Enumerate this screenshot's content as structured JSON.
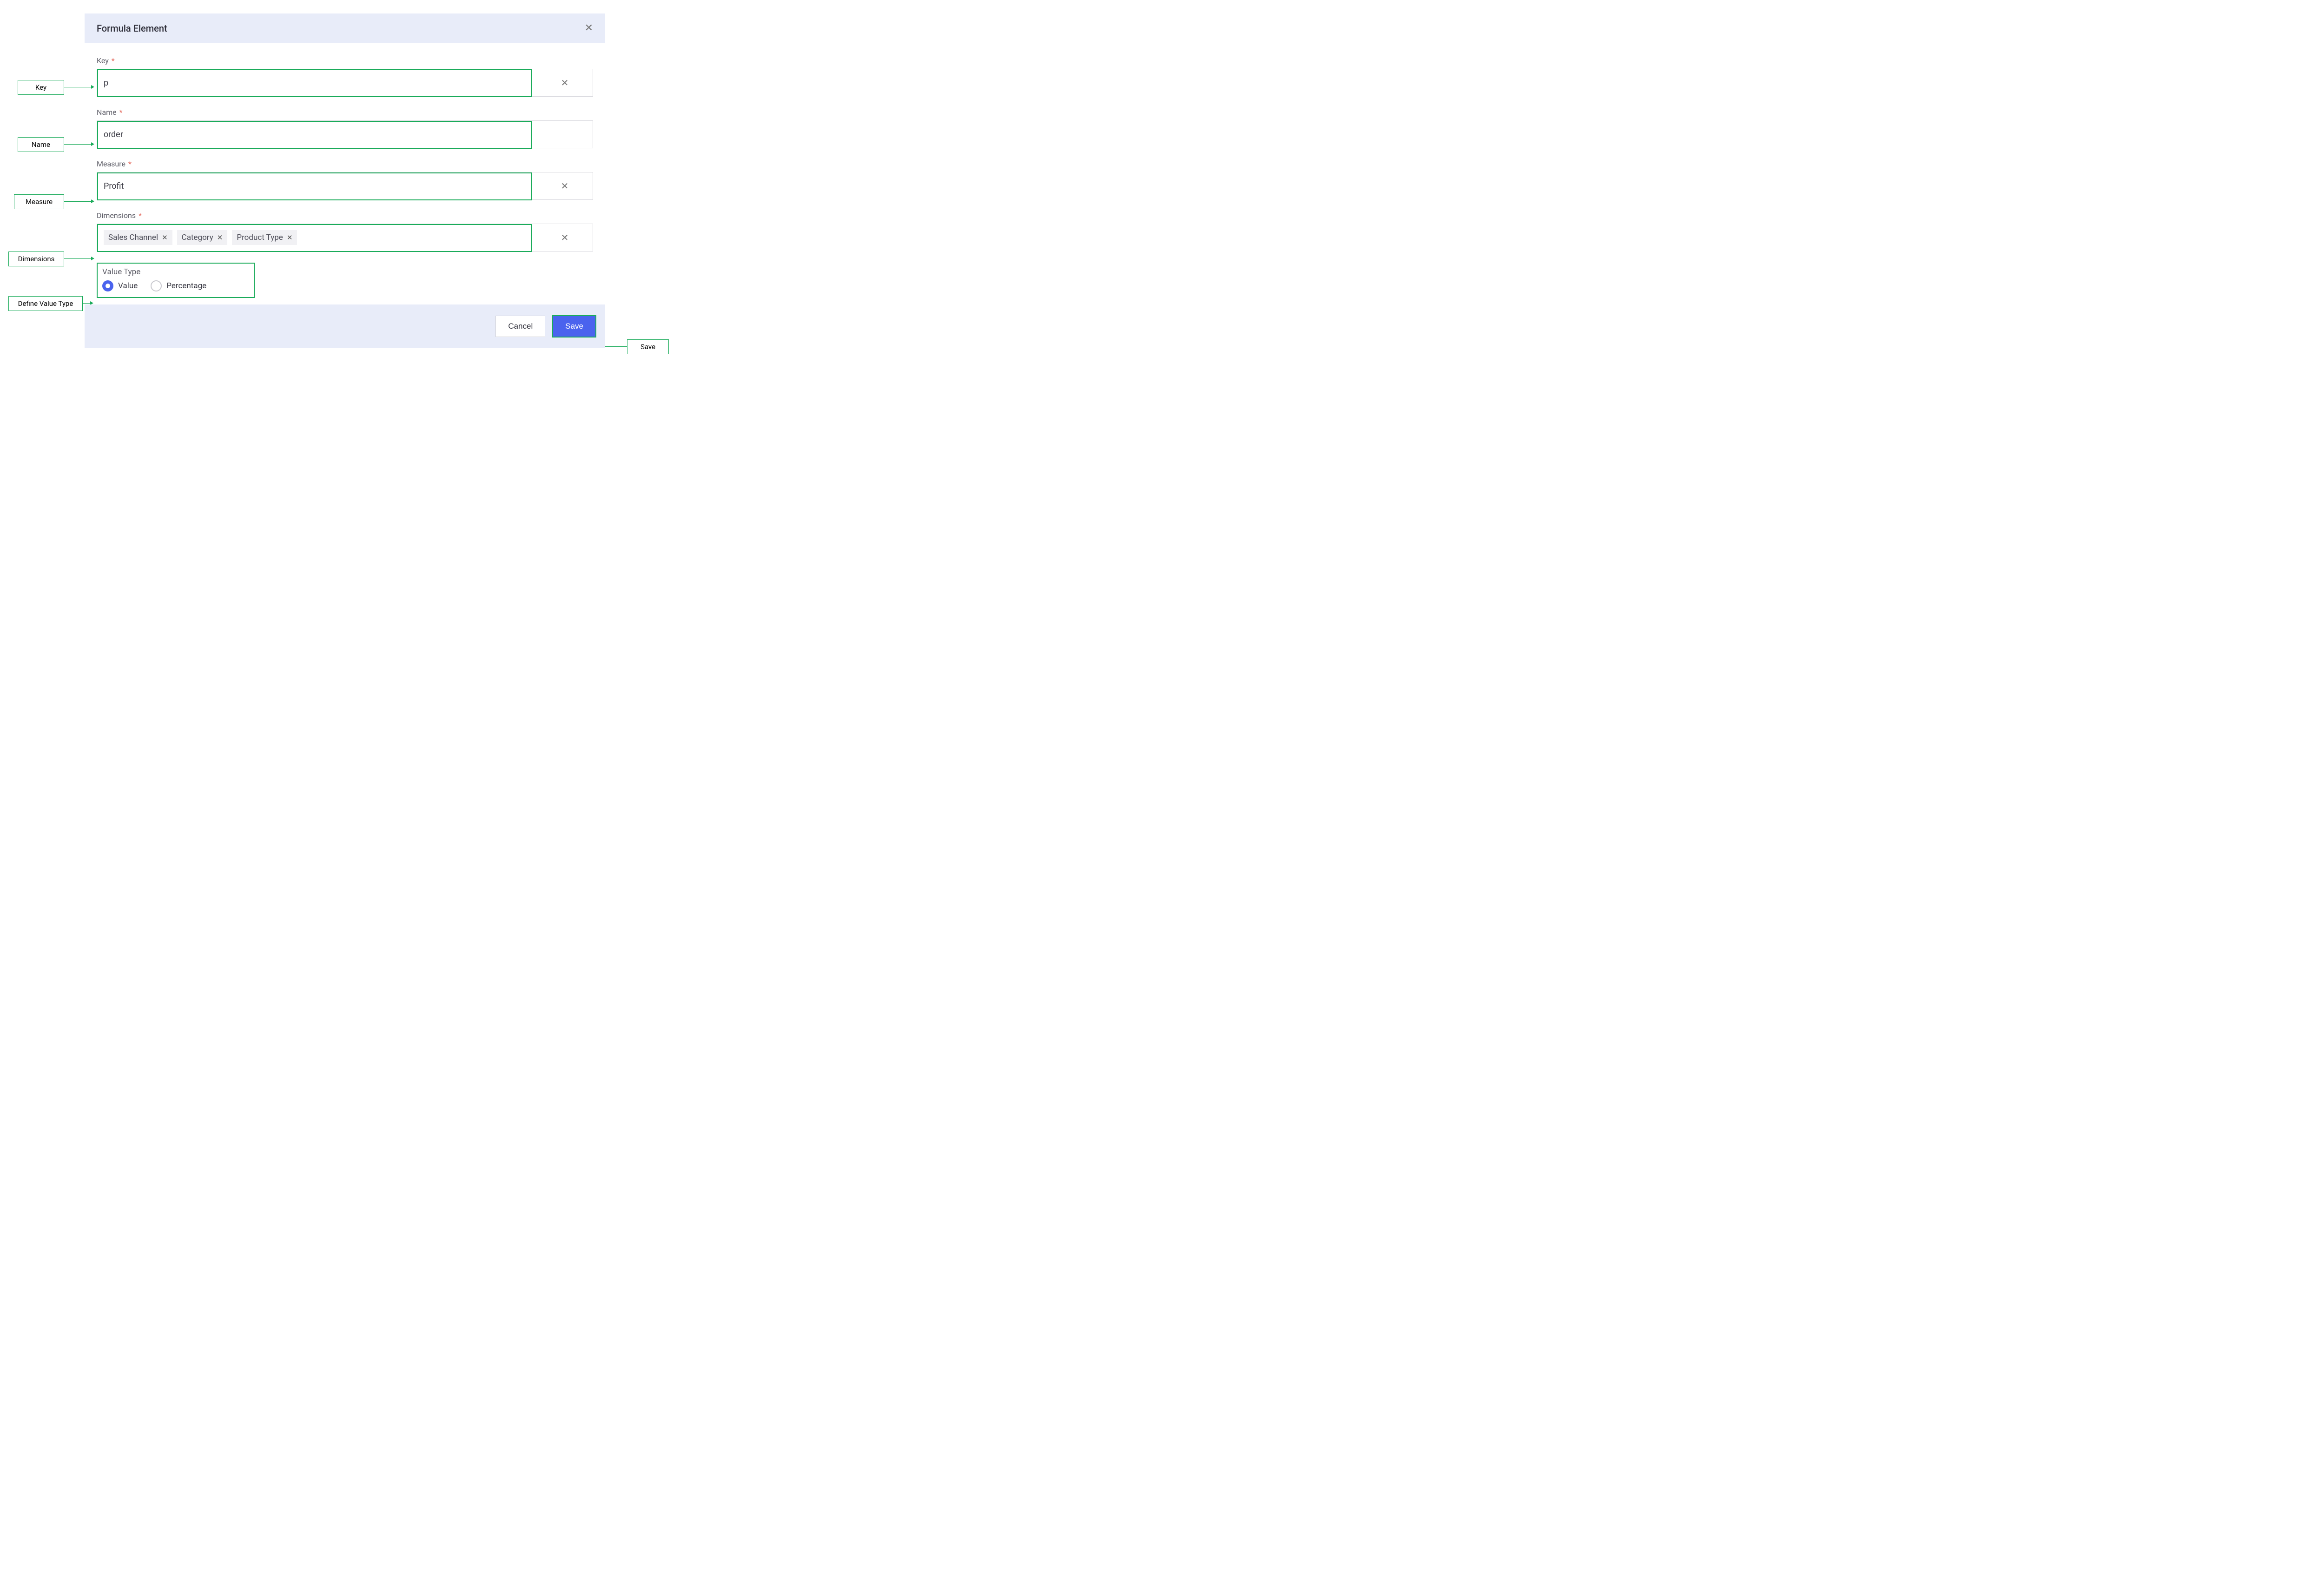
{
  "dialog": {
    "title": "Formula Element",
    "fields": {
      "key": {
        "label": "Key",
        "value": "p"
      },
      "name": {
        "label": "Name",
        "value": "order"
      },
      "measure": {
        "label": "Measure",
        "value": "Profit"
      },
      "dimensions": {
        "label": "Dimensions",
        "chips": [
          "Sales Channel",
          "Category",
          "Product Type"
        ]
      }
    },
    "valueType": {
      "label": "Value Type",
      "options": {
        "value": "Value",
        "percentage": "Percentage"
      },
      "selected": "value"
    },
    "buttons": {
      "cancel": "Cancel",
      "save": "Save"
    }
  },
  "callouts": {
    "key": "Key",
    "name": "Name",
    "measure": "Measure",
    "dimensions": "Dimensions",
    "valueType": "Define Value Type",
    "save": "Save"
  }
}
